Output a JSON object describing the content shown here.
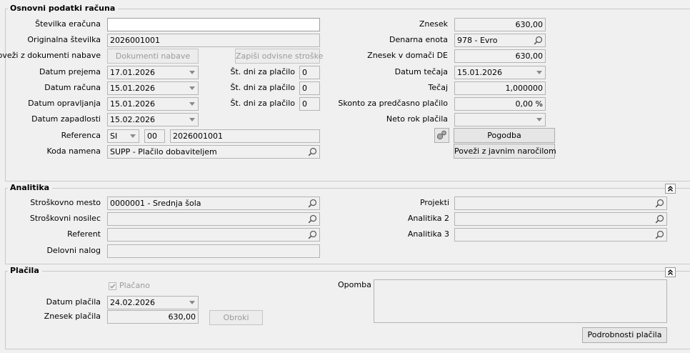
{
  "osnovni": {
    "title": "Osnovni podatki računa",
    "stevilka_label": "Številka eračuna",
    "stevilka_value": "",
    "originalna_label": "Originalna številka",
    "originalna_value": "2026001001",
    "povezi_label": "Poveži z dokumenti nabave",
    "dokumenti_button": "Dokumenti nabave",
    "zapisi_button": "Zapiši odvisne stroške",
    "datum_prejema_label": "Datum prejema",
    "datum_prejema_value": "17.01.2026",
    "datum_racuna_label": "Datum računa",
    "datum_racuna_value": "15.01.2026",
    "datum_opravljanja_label": "Datum opravljanja",
    "datum_opravljanja_value": "15.01.2026",
    "datum_zapadlosti_label": "Datum zapadlosti",
    "datum_zapadlosti_value": "15.02.2026",
    "st_dni_label": "Št. dni za plačilo",
    "st_dni_1": "0",
    "st_dni_2": "0",
    "st_dni_3": "0",
    "referenca_label": "Referenca",
    "referenca_model": "SI",
    "referenca_code": "00",
    "referenca_number": "2026001001",
    "koda_label": "Koda namena",
    "koda_value": "SUPP - Plačilo dobaviteljem",
    "znesek_label": "Znesek",
    "znesek_value": "630,00",
    "denarna_label": "Denarna enota",
    "denarna_value": "978 - Evro",
    "znesek_domaci_label": "Znesek v domači DE",
    "znesek_domaci_value": "630,00",
    "datum_tecaja_label": "Datum tečaja",
    "datum_tecaja_value": "15.01.2026",
    "tecaj_label": "Tečaj",
    "tecaj_value": "1,000000",
    "skonto_label": "Skonto za predčasno plačilo",
    "skonto_value": "0,00 %",
    "neto_label": "Neto rok plačila",
    "neto_value": "",
    "pogodba_button": "Pogodba",
    "javnim_button": "Poveži z javnim naročilom"
  },
  "analitika": {
    "title": "Analitika",
    "stroskovno_mesto_label": "Stroškovno mesto",
    "stroskovno_mesto_value": "0000001 - Srednja šola",
    "stroskovni_nosilec_label": "Stroškovni nosilec",
    "stroskovni_nosilec_value": "",
    "referent_label": "Referent",
    "referent_value": "",
    "delovni_label": "Delovni nalog",
    "delovni_value": "",
    "projekti_label": "Projekti",
    "projekti_value": "",
    "analitika2_label": "Analitika 2",
    "analitika2_value": "",
    "analitika3_label": "Analitika 3",
    "analitika3_value": ""
  },
  "placila": {
    "title": "Plačila",
    "placano_label": "Plačano",
    "placano_checked": true,
    "datum_label": "Datum plačila",
    "datum_value": "24.02.2026",
    "znesek_label": "Znesek plačila",
    "znesek_value": "630,00",
    "obroki_button": "Obroki",
    "opomba_label": "Opomba",
    "opomba_value": "",
    "podrobnosti_button": "Podrobnosti plačila"
  },
  "colors": {
    "background": "#f0f0f0",
    "field_border": "#b4b4b4",
    "disabled_text": "#9b9b9b"
  }
}
